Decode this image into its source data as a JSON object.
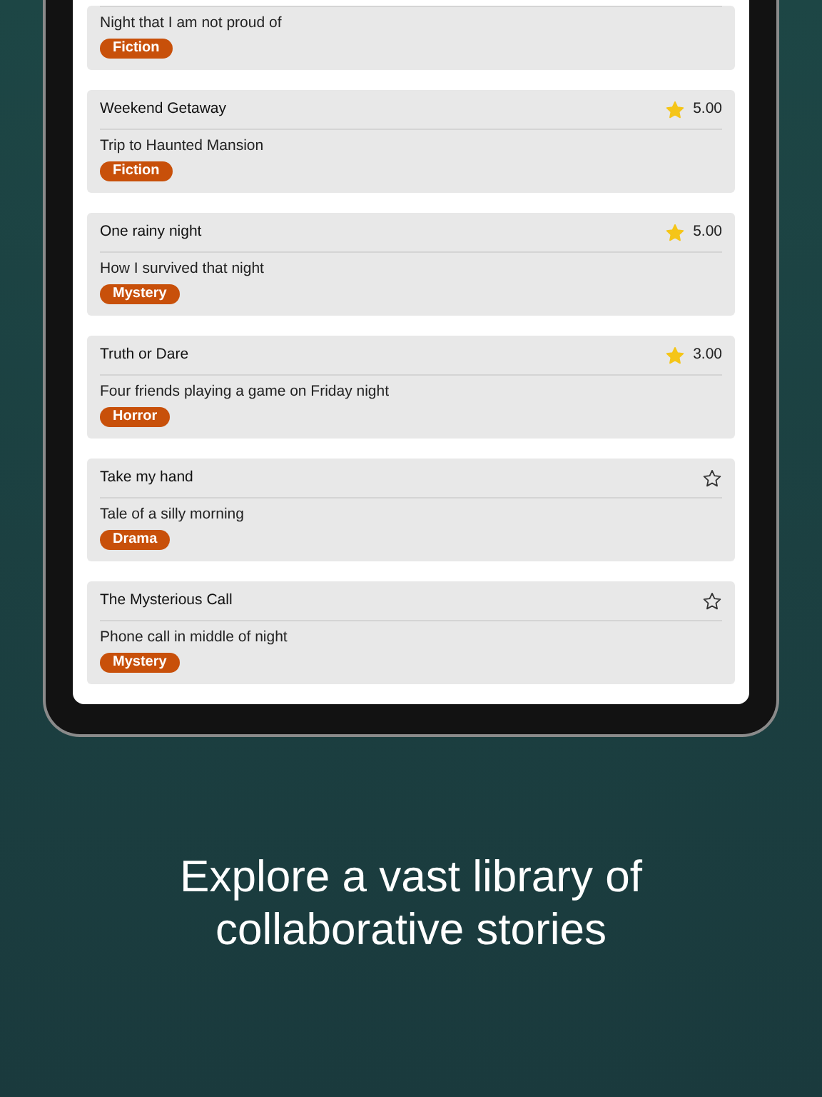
{
  "stories": [
    {
      "description": "Night that I am not proud of",
      "tag": "Fiction",
      "clipped": true
    },
    {
      "title": "Weekend Getaway",
      "starred": true,
      "rating": "5.00",
      "description": "Trip to Haunted Mansion",
      "tag": "Fiction"
    },
    {
      "title": "One rainy night",
      "starred": true,
      "rating": "5.00",
      "description": "How I survived that night",
      "tag": "Mystery"
    },
    {
      "title": "Truth or Dare",
      "starred": true,
      "rating": "3.00",
      "description": "Four friends playing a game on Friday night",
      "tag": "Horror"
    },
    {
      "title": "Take my hand",
      "starred": false,
      "description": "Tale of a silly morning",
      "tag": "Drama"
    },
    {
      "title": "The Mysterious Call",
      "starred": false,
      "description": "Phone call in middle of night",
      "tag": "Mystery"
    }
  ],
  "caption": "Explore a vast library of collaborative stories"
}
